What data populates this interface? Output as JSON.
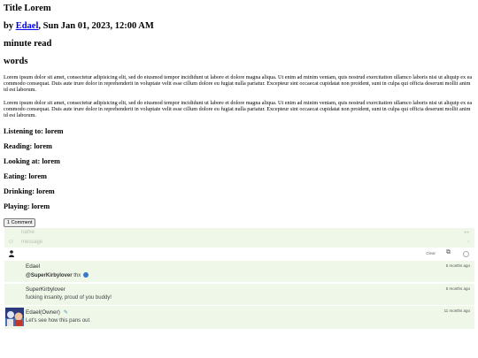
{
  "post": {
    "title": "Title Lorem",
    "byline_prefix": "by ",
    "author": "Edael",
    "date": ", Sun Jan 01, 2023, 12:00 AM",
    "read_time": "minute read",
    "words": "words",
    "paragraphs": [
      "Lorem ipsum dolor sit amet, consectetur adipisicing elit, sed do eiusmod tempor incididunt ut labore et dolore magna aliqua. Ut enim ad minim veniam, quis nostrud exercitation ullamco laboris nisi ut aliquip ex ea commodo consequat. Duis aute irure dolor in reprehenderit in voluptate velit esse cillum dolore eu fugiat nulla pariatur. Excepteur sint occaecat cupidatat non proident, sunt in culpa qui officia deserunt mollit anim id est laborum.",
      "Lorem ipsum dolor sit amet, consectetur adipisicing elit, sed do eiusmod tempor incididunt ut labore et dolore magna aliqua. Ut enim ad minim veniam, quis nostrud exercitation ullamco laboris nisi ut aliquip ex ea commodo consequat. Duis aute irure dolor in reprehenderit in voluptate velit esse cillum dolore eu fugiat nulla pariatur. Excepteur sint occaecat cupidatat non proident, sunt in culpa qui officia deserunt mollit anim id est laborum."
    ],
    "meta": [
      "Listening to: lorem",
      "Reading: lorem",
      "Looking at: lorem",
      "Eating: lorem",
      "Drinking: lorem",
      "Playing: lorem"
    ]
  },
  "comments": {
    "button_label": "1 Comment",
    "name_placeholder": "name",
    "message_placeholder": "message",
    "clear_label": "Clear",
    "items": [
      {
        "author": "Edael",
        "time": "5 months ago",
        "mention": "@SuperKirbylover",
        "text": " thx "
      },
      {
        "author": "SuperKirbylover",
        "time": "5 months ago",
        "text": "fucking insanity, proud of you buddy!"
      },
      {
        "author": "Edael(Owner)",
        "time": "11 months ago",
        "text": "Let's see how this pans out"
      }
    ]
  }
}
